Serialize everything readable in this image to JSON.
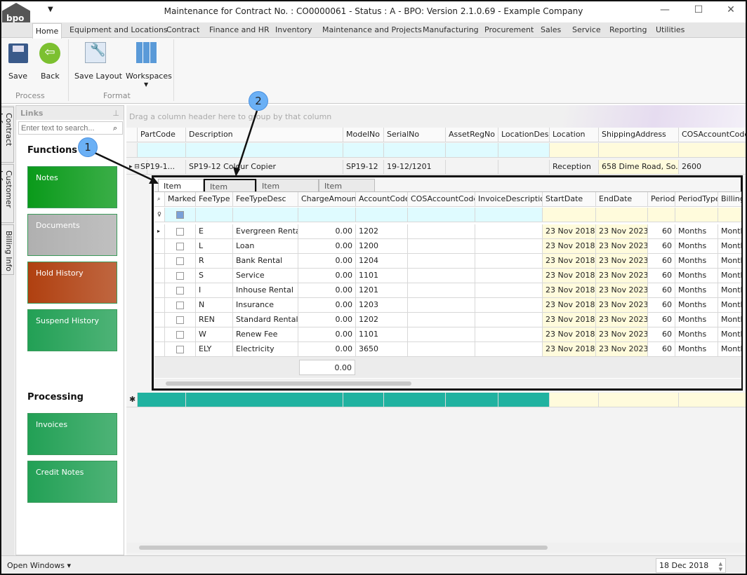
{
  "window": {
    "title": "Maintenance for Contract No. : CO0000061 - Status : A - BPO: Version 2.1.0.69 - Example Company",
    "logo_text": "bpo"
  },
  "ribbon_tabs": [
    "Home",
    "Equipment and Locations",
    "Contract",
    "Finance and HR",
    "Inventory",
    "Maintenance and Projects",
    "Manufacturing",
    "Procurement",
    "Sales",
    "Service",
    "Reporting",
    "Utilities"
  ],
  "ribbon": {
    "save": "Save",
    "back": "Back",
    "save_layout": "Save Layout",
    "workspaces": "Workspaces",
    "group_process": "Process",
    "group_format": "Format"
  },
  "side_tabs": [
    "Contract Info",
    "Customer Info",
    "Billing Info"
  ],
  "links": {
    "title": "Links",
    "search_placeholder": "Enter text to search...",
    "functions": "Functions",
    "processing": "Processing",
    "function_tiles": [
      {
        "label": "Notes",
        "color": "#0a9a1a"
      },
      {
        "label": "Documents",
        "color": "#b0b0b0"
      },
      {
        "label": "Hold History",
        "color": "#b04010"
      },
      {
        "label": "Suspend History",
        "color": "#22a055"
      }
    ],
    "processing_tiles": [
      {
        "label": "Invoices",
        "color": "#22a055"
      },
      {
        "label": "Credit Notes",
        "color": "#22a055"
      }
    ]
  },
  "grid": {
    "group_hint": "Drag a column header here to group by that column",
    "columns": [
      "PartCode",
      "Description",
      "ModelNo",
      "SerialNo",
      "AssetRegNo",
      "LocationDesc",
      "Location",
      "ShippingAddress",
      "COSAccountCode"
    ],
    "row": [
      "SP19-1...",
      "SP19-12 Colour Copier",
      "SP19-12",
      "19-12/1201",
      "",
      "",
      "Reception",
      "658 Dime Road, So...",
      "2600"
    ],
    "new_row_color": "#20b2a0"
  },
  "detail": {
    "tabs": [
      "Item Fees",
      "Item Meters",
      "Item Inclusions",
      "Item Contacts"
    ],
    "active_tab": "Item Fees",
    "columns": [
      "Marked",
      "FeeType",
      "FeeTypeDesc",
      "ChargeAmount",
      "AccountCode",
      "COSAccountCode",
      "InvoiceDescription",
      "StartDate",
      "EndDate",
      "Period",
      "PeriodType",
      "BillingC"
    ],
    "rows": [
      [
        "E",
        "Evergreen Rental",
        "0.00",
        "1202",
        "",
        "",
        "23 Nov 2018",
        "23 Nov 2023",
        "60",
        "Months",
        "Month"
      ],
      [
        "L",
        "Loan",
        "0.00",
        "1200",
        "",
        "",
        "23 Nov 2018",
        "23 Nov 2023",
        "60",
        "Months",
        "Month"
      ],
      [
        "R",
        "Bank Rental",
        "0.00",
        "1204",
        "",
        "",
        "23 Nov 2018",
        "23 Nov 2023",
        "60",
        "Months",
        "Month"
      ],
      [
        "S",
        "Service",
        "0.00",
        "1101",
        "",
        "",
        "23 Nov 2018",
        "23 Nov 2023",
        "60",
        "Months",
        "Month"
      ],
      [
        "I",
        "Inhouse Rental",
        "0.00",
        "1201",
        "",
        "",
        "23 Nov 2018",
        "23 Nov 2023",
        "60",
        "Months",
        "Month"
      ],
      [
        "N",
        "Insurance",
        "0.00",
        "1203",
        "",
        "",
        "23 Nov 2018",
        "23 Nov 2023",
        "60",
        "Months",
        "Month"
      ],
      [
        "REN",
        "Standard Rentals",
        "0.00",
        "1202",
        "",
        "",
        "23 Nov 2018",
        "23 Nov 2023",
        "60",
        "Months",
        "Month"
      ],
      [
        "W",
        "Renew Fee",
        "0.00",
        "1101",
        "",
        "",
        "23 Nov 2018",
        "23 Nov 2023",
        "60",
        "Months",
        "Month"
      ],
      [
        "ELY",
        "Electricity",
        "0.00",
        "3650",
        "",
        "",
        "23 Nov 2018",
        "23 Nov 2023",
        "60",
        "Months",
        "Month"
      ]
    ],
    "total": "0.00"
  },
  "callouts": [
    "1",
    "2"
  ],
  "status": {
    "open_windows": "Open Windows",
    "date": "18 Dec 2018"
  }
}
